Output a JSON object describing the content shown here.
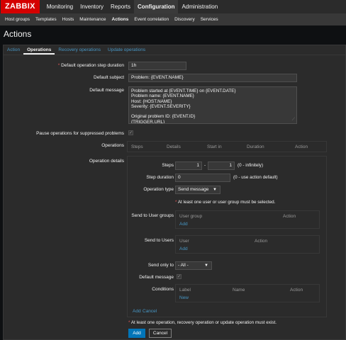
{
  "header": {
    "logo": "ZABBIX",
    "nav": [
      "Monitoring",
      "Inventory",
      "Reports",
      "Configuration",
      "Administration"
    ],
    "active_nav": "Configuration"
  },
  "subnav": {
    "items": [
      "Host groups",
      "Templates",
      "Hosts",
      "Maintenance",
      "Actions",
      "Event correlation",
      "Discovery",
      "Services"
    ],
    "active": "Actions"
  },
  "page": {
    "title": "Actions"
  },
  "tabs": [
    "Action",
    "Operations",
    "Recovery operations",
    "Update operations"
  ],
  "active_tab": "Operations",
  "form": {
    "step_duration_label": "Default operation step duration",
    "step_duration_value": "1h",
    "subject_label": "Default subject",
    "subject_value": "Problem: {EVENT.NAME}",
    "message_label": "Default message",
    "message_value": "Problem started at {EVENT.TIME} on {EVENT.DATE}\nProblem name: {EVENT.NAME}\nHost: {HOST.NAME}\nSeverity: {EVENT.SEVERITY}\n\nOriginal problem ID: {EVENT.ID}\n{TRIGGER.URL}",
    "pause_label": "Pause operations for suppressed problems",
    "pause_checked": true,
    "operations_label": "Operations",
    "operations_columns": [
      "Steps",
      "Details",
      "Start in",
      "Duration",
      "Action"
    ],
    "operation_details_label": "Operation details",
    "steps_label": "Steps",
    "steps_from": "1",
    "steps_sep": "-",
    "steps_to": "1",
    "steps_hint": "(0 - infinitely)",
    "step_duration2_label": "Step duration",
    "step_duration2_value": "0",
    "step_duration2_hint": "(0 - use action default)",
    "operation_type_label": "Operation type",
    "operation_type_value": "Send message",
    "user_note": "At least one user or user group must be selected.",
    "send_groups_label": "Send to User groups",
    "groups_columns": [
      "User group",
      "Action"
    ],
    "groups_add": "Add",
    "send_users_label": "Send to Users",
    "users_columns": [
      "User",
      "Action"
    ],
    "users_add": "Add",
    "send_only_label": "Send only to",
    "send_only_value": "- All -",
    "default_message_label": "Default message",
    "default_message_checked": true,
    "conditions_label": "Conditions",
    "conditions_columns": [
      "Label",
      "Name",
      "Action"
    ],
    "conditions_new": "New",
    "op_add": "Add",
    "op_cancel": "Cancel",
    "bottom_note": "At least one operation, recovery operation or update operation must exist.",
    "add_button": "Add",
    "cancel_button": "Cancel"
  }
}
